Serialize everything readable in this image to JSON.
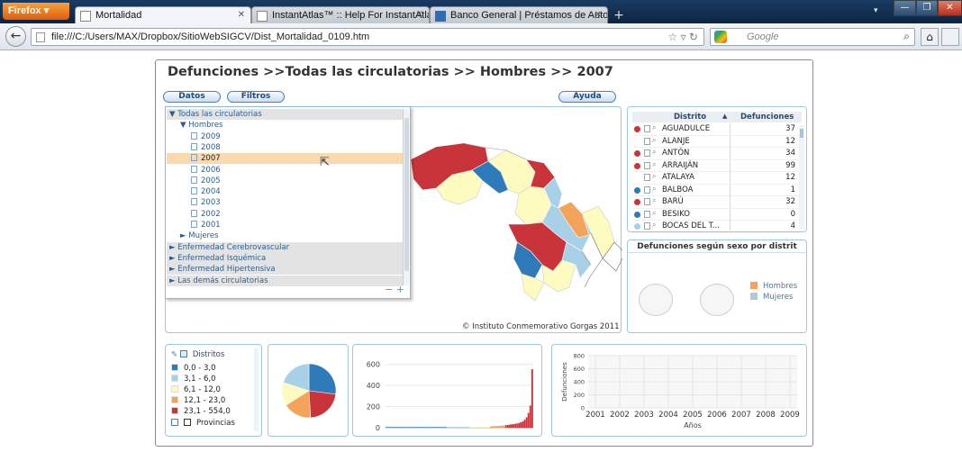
{
  "browser": {
    "app_button": "Firefox",
    "tabs": [
      {
        "title": "Mortalidad"
      },
      {
        "title": "InstantAtlas™ :: Help For InstantAtlas"
      },
      {
        "title": "Banco General | Préstamos de Autos"
      }
    ],
    "url": "file:///C:/Users/MAX/Dropbox/SitioWebSIGCV/Dist_Mortalidad_0109.htm",
    "search_placeholder": "Google"
  },
  "header": {
    "title": "Defunciones >>Todas las circulatorias >> Hombres >>  2007",
    "buttons": {
      "datos": "Datos",
      "filtros": "Filtros",
      "ayuda": "Ayuda"
    }
  },
  "tree": {
    "items": [
      {
        "label": "▼ Todas las circulatorias",
        "level": 0,
        "kind": "group"
      },
      {
        "label": "▼ Hombres",
        "level": 1,
        "kind": "node"
      },
      {
        "label": "2009",
        "level": 2,
        "kind": "file"
      },
      {
        "label": "2008",
        "level": 2,
        "kind": "file"
      },
      {
        "label": "2007",
        "level": 2,
        "kind": "file",
        "selected": true
      },
      {
        "label": "2006",
        "level": 2,
        "kind": "file"
      },
      {
        "label": "2005",
        "level": 2,
        "kind": "file"
      },
      {
        "label": "2004",
        "level": 2,
        "kind": "file"
      },
      {
        "label": "2003",
        "level": 2,
        "kind": "file"
      },
      {
        "label": "2002",
        "level": 2,
        "kind": "file"
      },
      {
        "label": "2001",
        "level": 2,
        "kind": "file"
      },
      {
        "label": "► Mujeres",
        "level": 1,
        "kind": "node"
      },
      {
        "label": "► Enfermedad Cerebrovascular",
        "level": 0,
        "kind": "group"
      },
      {
        "label": "► Enfermedad Isquémica",
        "level": 0,
        "kind": "group"
      },
      {
        "label": "► Enfermedad Hipertensiva",
        "level": 0,
        "kind": "group"
      },
      {
        "label": "► Las demás circulatorias",
        "level": 0,
        "kind": "group"
      }
    ],
    "zoom_controls": "− +"
  },
  "map": {
    "copyright": "© Instituto Conmemorativo Gorgas 2011"
  },
  "district_table": {
    "columns": [
      "Distrito",
      "▲",
      "Defunciones"
    ],
    "rows": [
      {
        "name": "AGUADULCE",
        "value": "37",
        "dot": "#c9343a"
      },
      {
        "name": "ALANJE",
        "value": "12",
        "dot": ""
      },
      {
        "name": "ANTÓN",
        "value": "34",
        "dot": "#c9343a"
      },
      {
        "name": "ARRAIJÁN",
        "value": "99",
        "dot": "#c9343a"
      },
      {
        "name": "ATALAYA",
        "value": "12",
        "dot": ""
      },
      {
        "name": "BALBOA",
        "value": "1",
        "dot": "#2f7ab8"
      },
      {
        "name": "BARÚ",
        "value": "32",
        "dot": "#c9343a"
      },
      {
        "name": "BESIKO",
        "value": "0",
        "dot": "#2f7ab8"
      },
      {
        "name": "BOCAS DEL T...",
        "value": "4",
        "dot": "#a8d0e6"
      }
    ]
  },
  "sex_chart": {
    "title": "Defunciones según sexo por distrit",
    "legend": [
      {
        "label": "Hombres",
        "color": "#f4a35a"
      },
      {
        "label": "Mujeres",
        "color": "#b0c8dc"
      }
    ]
  },
  "map_legend": {
    "layer_label": "Distritos",
    "classes": [
      {
        "label": "0,0 - 3,0",
        "color": "#2f7ab8"
      },
      {
        "label": "3,1 - 6,0",
        "color": "#a8d0e6"
      },
      {
        "label": "6,1 - 12,0",
        "color": "#fdfbc0"
      },
      {
        "label": "12,1 - 23,0",
        "color": "#f4a35a"
      },
      {
        "label": "23,1 - 554,0",
        "color": "#c9343a"
      }
    ],
    "provinces_label": "Provincias"
  },
  "pie": {
    "chart_data": {
      "type": "pie",
      "slices": [
        {
          "label": "0,0 - 3,0",
          "value": 27,
          "color": "#2f7ab8"
        },
        {
          "label": "23,1 - 554,0",
          "value": 22,
          "color": "#c9343a"
        },
        {
          "label": "12,1 - 23,0",
          "value": 17,
          "color": "#f4a35a"
        },
        {
          "label": "6,1 - 12,0",
          "value": 14,
          "color": "#fdfbc0"
        },
        {
          "label": "3,1 - 6,0",
          "value": 20,
          "color": "#a8d0e6"
        }
      ]
    }
  },
  "bars": {
    "chart_data": {
      "type": "bar",
      "ylim": [
        0,
        700
      ],
      "yticks": [
        "0",
        "200",
        "400",
        "600"
      ],
      "values": [
        1,
        1,
        1,
        1,
        1,
        1,
        1,
        1,
        1,
        1,
        1,
        1,
        1,
        1,
        1,
        2,
        2,
        2,
        2,
        2,
        2,
        2,
        2,
        2,
        2,
        3,
        3,
        3,
        3,
        3,
        3,
        3,
        3,
        4,
        4,
        4,
        4,
        4,
        5,
        5,
        5,
        5,
        6,
        6,
        6,
        7,
        7,
        8,
        8,
        9,
        9,
        10,
        10,
        11,
        12,
        12,
        13,
        14,
        15,
        16,
        17,
        18,
        20,
        22,
        24,
        26,
        29,
        32,
        34,
        37,
        40,
        45,
        52,
        60,
        75,
        99,
        140,
        210,
        554
      ]
    }
  },
  "timeline": {
    "chart_data": {
      "type": "line",
      "x": [
        "2001",
        "2002",
        "2003",
        "2004",
        "2005",
        "2006",
        "2007",
        "2008",
        "2009"
      ],
      "ylabel": "Defunciones",
      "xlabel": "Años",
      "yticks": [
        "0",
        "200",
        "400",
        "600",
        "800"
      ],
      "ylim": [
        0,
        800
      ]
    }
  }
}
